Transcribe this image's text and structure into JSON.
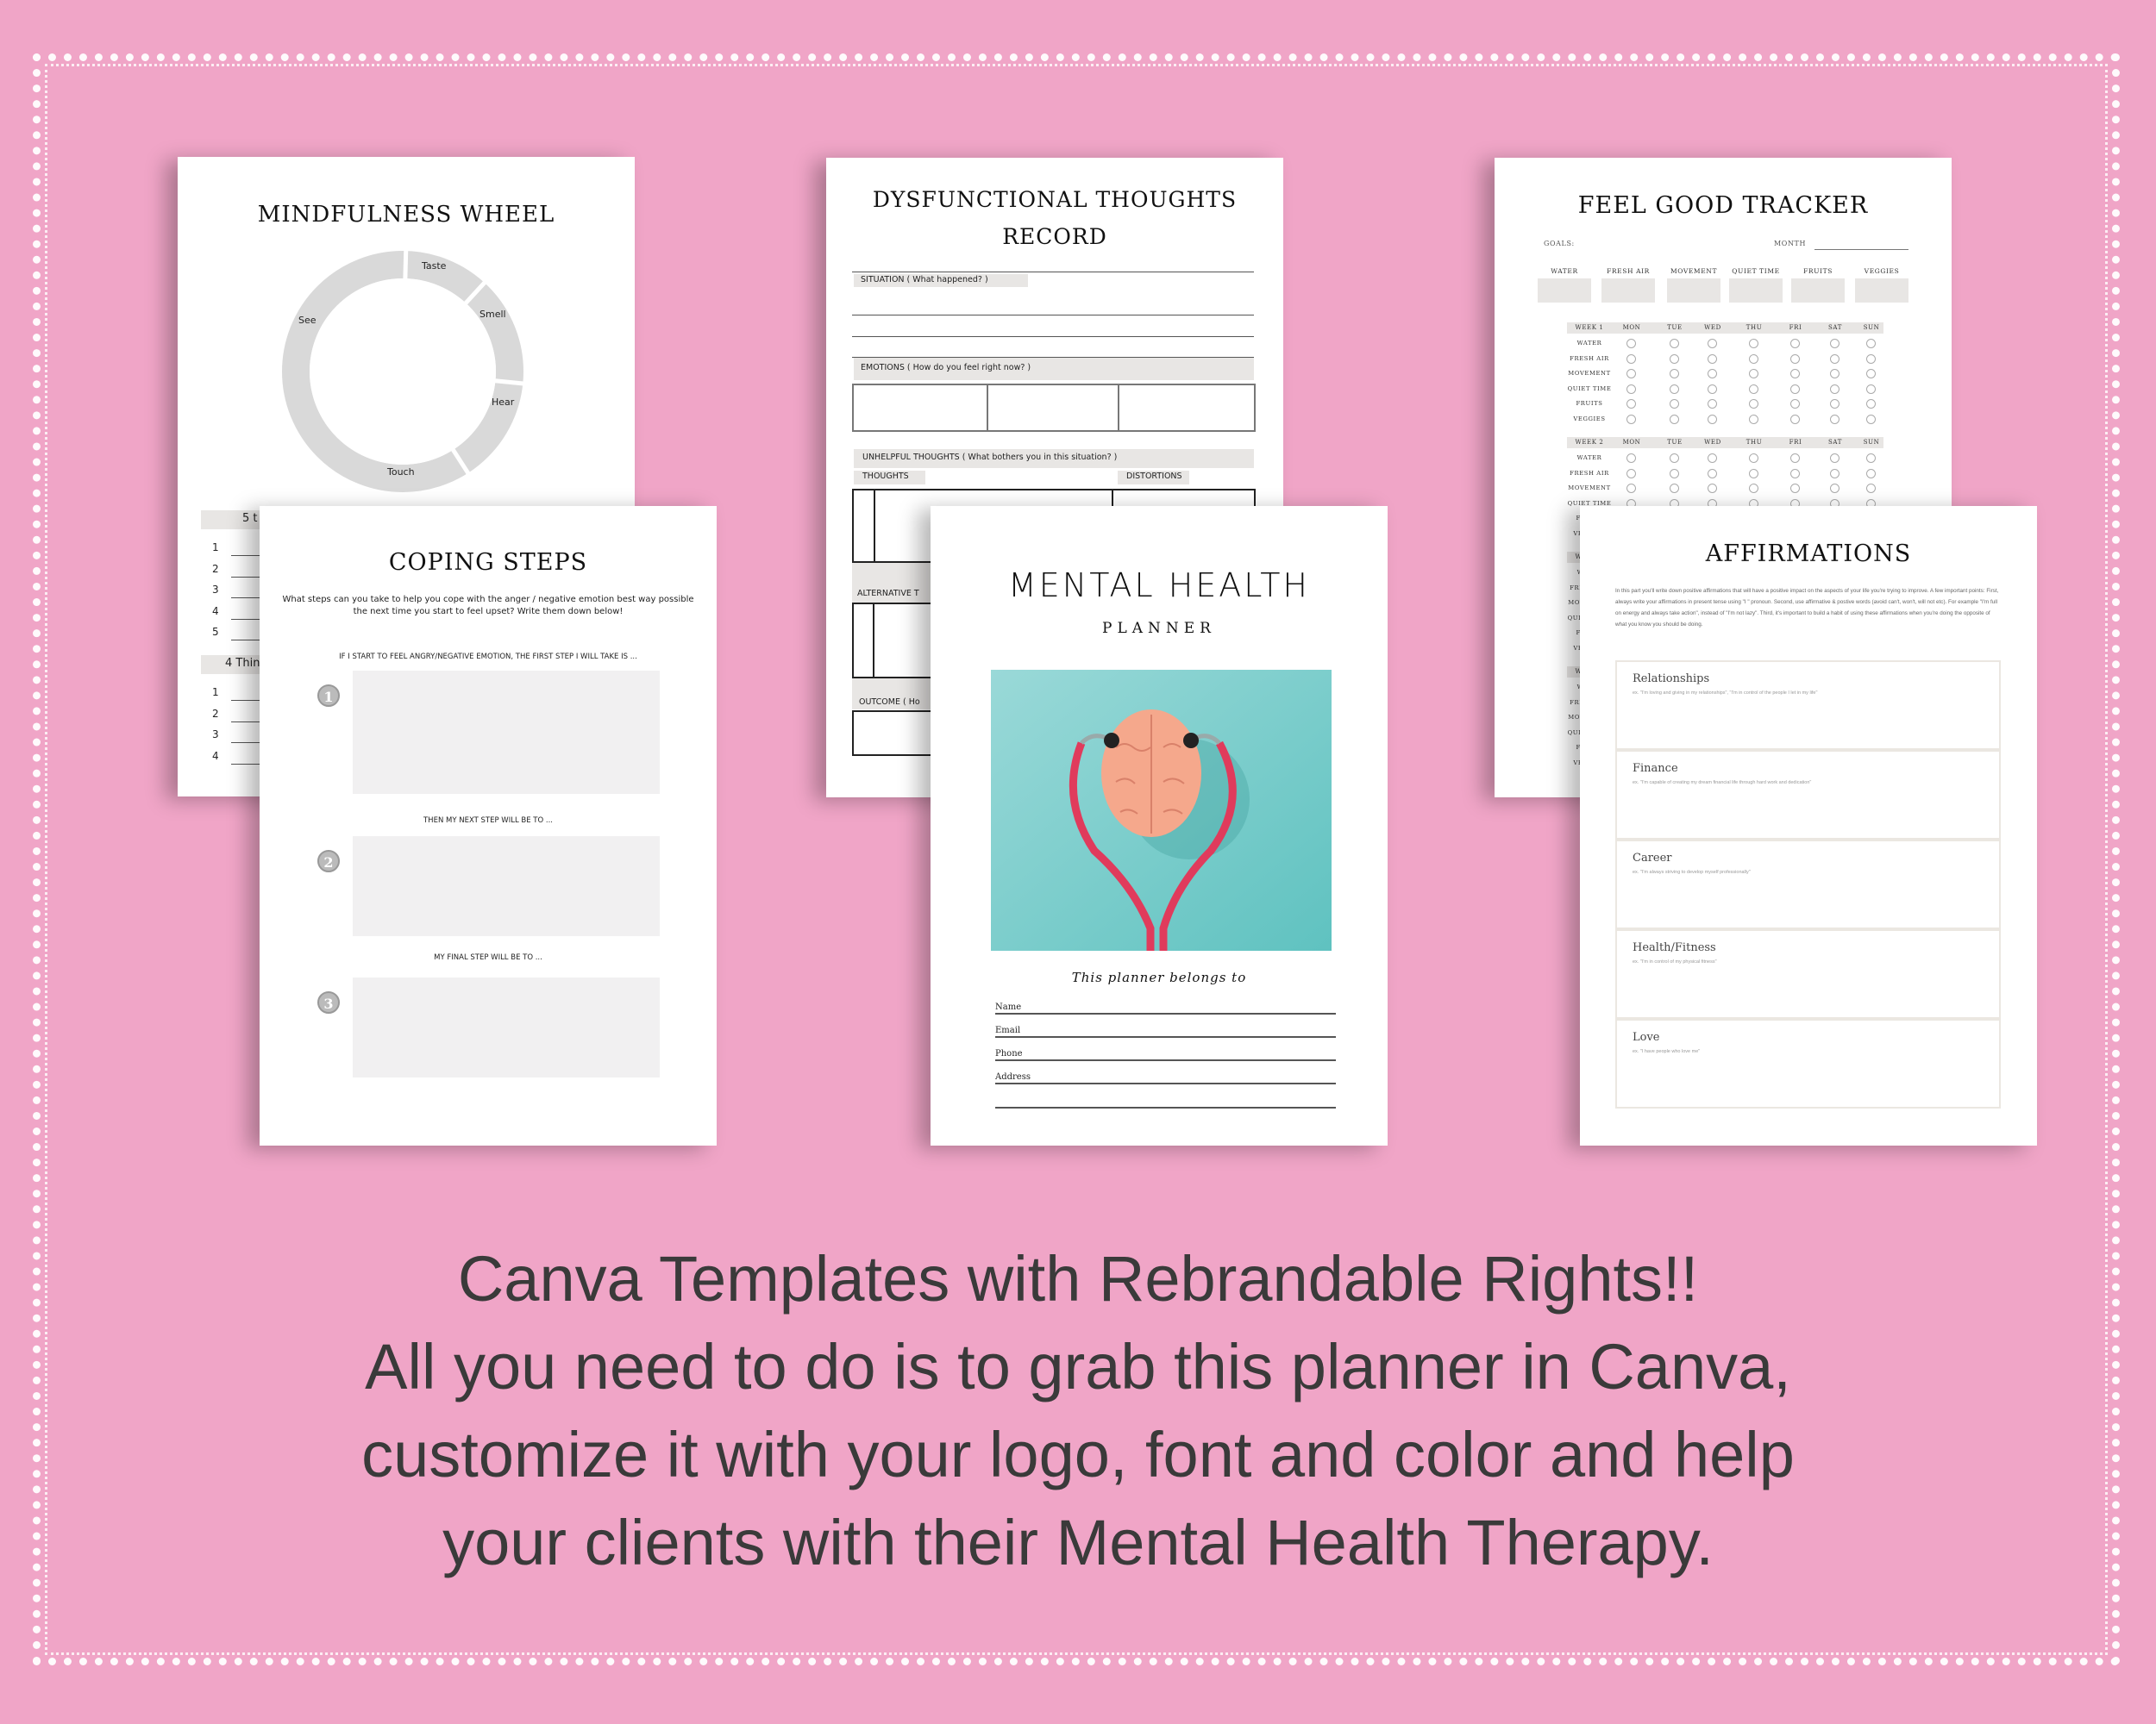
{
  "colors": {
    "background": "#f0a5c7",
    "gray_fill": "#e8e6e4",
    "wheel": "#d9d9d9",
    "caption": "#3a3a3a"
  },
  "mindfulness": {
    "title": "MINDFULNESS  WHEEL",
    "senses": [
      "Taste",
      "Smell",
      "Hear",
      "Touch",
      "See"
    ],
    "list1_header": "5 t",
    "list1_numbers": [
      "1",
      "2",
      "3",
      "4",
      "5"
    ],
    "list2_header": "4 Thin",
    "list2_numbers": [
      "1",
      "2",
      "3",
      "4"
    ]
  },
  "coping": {
    "title": "COPING STEPS",
    "intro": "What steps can you take to help you cope with the anger / negative emotion best way possible the next time you start to feel upset? Write them down below!",
    "steps": [
      {
        "num": "1",
        "label": "IF I START TO FEEL ANGRY/NEGATIVE EMOTION, THE FIRST STEP I WILL TAKE IS ..."
      },
      {
        "num": "2",
        "label": "THEN MY NEXT STEP WILL BE TO ..."
      },
      {
        "num": "3",
        "label": "MY FINAL STEP WILL BE TO ..."
      }
    ]
  },
  "dysfunctional": {
    "title_line1": "DYSFUNCTIONAL  THOUGHTS",
    "title_line2": "RECORD",
    "situation": "SITUATION  ( What  happened? )",
    "emotions": "EMOTIONS   ( How  do  you  feel  right  now? )",
    "unhelpful": "UNHELPFUL THOUGHTS  ( What  bothers  you  in  this  situation? )",
    "thoughts": "THOUGHTS",
    "distortions": "DISTORTIONS",
    "alternative": "ALTERNATIVE  T",
    "outcome": "OUTCOME  ( Ho"
  },
  "cover": {
    "title": "MENTAL HEALTH",
    "subtitle": "PLANNER",
    "belongs": "This planner belongs to",
    "fields": [
      "Name",
      "Email",
      "Phone",
      "Address"
    ]
  },
  "tracker": {
    "title": "FEEL GOOD TRACKER",
    "goals_label": "GOALS:",
    "month_label": "MONTH",
    "goals": [
      "WATER",
      "FRESH AIR",
      "MOVEMENT",
      "QUIET TIME",
      "FRUITS",
      "VEGGIES"
    ],
    "days": [
      "MON",
      "TUE",
      "WED",
      "THU",
      "FRI",
      "SAT",
      "SUN"
    ],
    "weeks": [
      "WEEK 1",
      "WEEK 2",
      "WEEK 3",
      "WEEK 4"
    ],
    "habits": [
      "WATER",
      "FRESH AIR",
      "MOVEMENT",
      "QUIET TIME",
      "FRUITS",
      "VEGGIES"
    ]
  },
  "affirmations": {
    "title": "AFFIRMATIONS",
    "intro": "In this part you'll write down positive affirmations that will have a positive impact on the aspects of your life you're trying to improve. A few important points: First, always write your affirmations in present tense using \"I \" pronoun. Second, use affirmative & postive words (avoid can't, won't, will not etc). For example \"I'm full on energy and always take action\", instead of \"I'm not lazy\". Third, it's important to  build a habit of using these affirmations when you're doing the opposite of what you know you should be doing.",
    "sections": [
      {
        "title": "Relationships",
        "example": "ex. \"I'm loving and giving in my relationships\", \"I'm in control of the people I let in my life\""
      },
      {
        "title": "Finance",
        "example": "ex. \"I'm capable of creating my dream financial life through hard work and dedication\""
      },
      {
        "title": "Career",
        "example": "ex. \"I'm always striving to develop myself professionally\""
      },
      {
        "title": "Health/Fitness",
        "example": "ex. \"I'm in control of my physical fitness\""
      },
      {
        "title": "Love",
        "example": "ex. \"I have people who love me\""
      }
    ]
  },
  "caption": {
    "lines": [
      "Canva Templates with Rebrandable Rights!!",
      "All you need to do is to grab this planner in Canva,",
      "customize it with your logo, font and color and help",
      "your clients with their Mental Health Therapy."
    ]
  }
}
